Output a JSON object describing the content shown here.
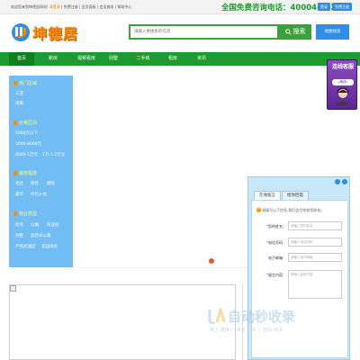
{
  "topbar": {
    "welcome_pre": "欢迎您来到坤德居网站! ",
    "welcome_link": "请登录",
    "welcome_post": " | 免费注册 | 会员面板 | 会员服务 | 帮助中心",
    "hotline": "全国免费咨询电话：40004-62226",
    "login_label": "登录",
    "register_label": "免费注册"
  },
  "header": {
    "logo_text": "坤德居",
    "search_placeholder": "请输入要搜索的信息",
    "search_button": "搜索",
    "map_button": "地图找房"
  },
  "nav": {
    "items": [
      "首页",
      "新房",
      "视频看房",
      "别墅",
      "二手房",
      "租房",
      "资讯"
    ]
  },
  "sidebar": {
    "area_title": "热门区域",
    "area_links": [
      "三亚",
      "海南"
    ],
    "price_title": "价格区间",
    "price_links": [
      "5000元以下",
      "5000-8000元",
      "8000-1万元",
      "1万-1.2万元"
    ],
    "feature_title": "装修程度",
    "feature_links": [
      "毛坯",
      "简装",
      "精装",
      "豪华",
      "拎包入住"
    ],
    "type_title": "物业类型",
    "type_links": [
      "住宅",
      "公寓",
      "商业街",
      "别墅",
      "酒店式公寓",
      "产权式酒店",
      "花园洋房"
    ]
  },
  "cs_float": {
    "title": "连线客服",
    "subtitle": "(离线)"
  },
  "message": {
    "tab_leave": "在线留言",
    "tab_reply": "给你回电",
    "hint": "请填写以下信息,我们会尽快和您联系。",
    "name_label": "您的姓名：",
    "name_placeholder": "请输入您的姓名",
    "phone_label": "电话号码：",
    "phone_placeholder": "请输入电话号码",
    "email_label": "电子邮箱：",
    "email_placeholder": "请输入电子邮箱",
    "content_label": "留言内容：",
    "content_placeholder": "请输入留言内容"
  },
  "watermark": {
    "big": "自动秒收录",
    "small": "做上 链接 一 来访 一次 一 自动 收录"
  },
  "colors": {
    "brand_green": "#1e9b2e",
    "sidebar_blue": "#71bdf4",
    "hotline_green": "#1b9b2b",
    "logo_orange": "#ff8a00"
  },
  "icons": [
    "logo-mark-icon",
    "search-icon",
    "alert-icon",
    "image-placeholder-icon",
    "cs-head-icon",
    "watermark-logo-icon"
  ]
}
